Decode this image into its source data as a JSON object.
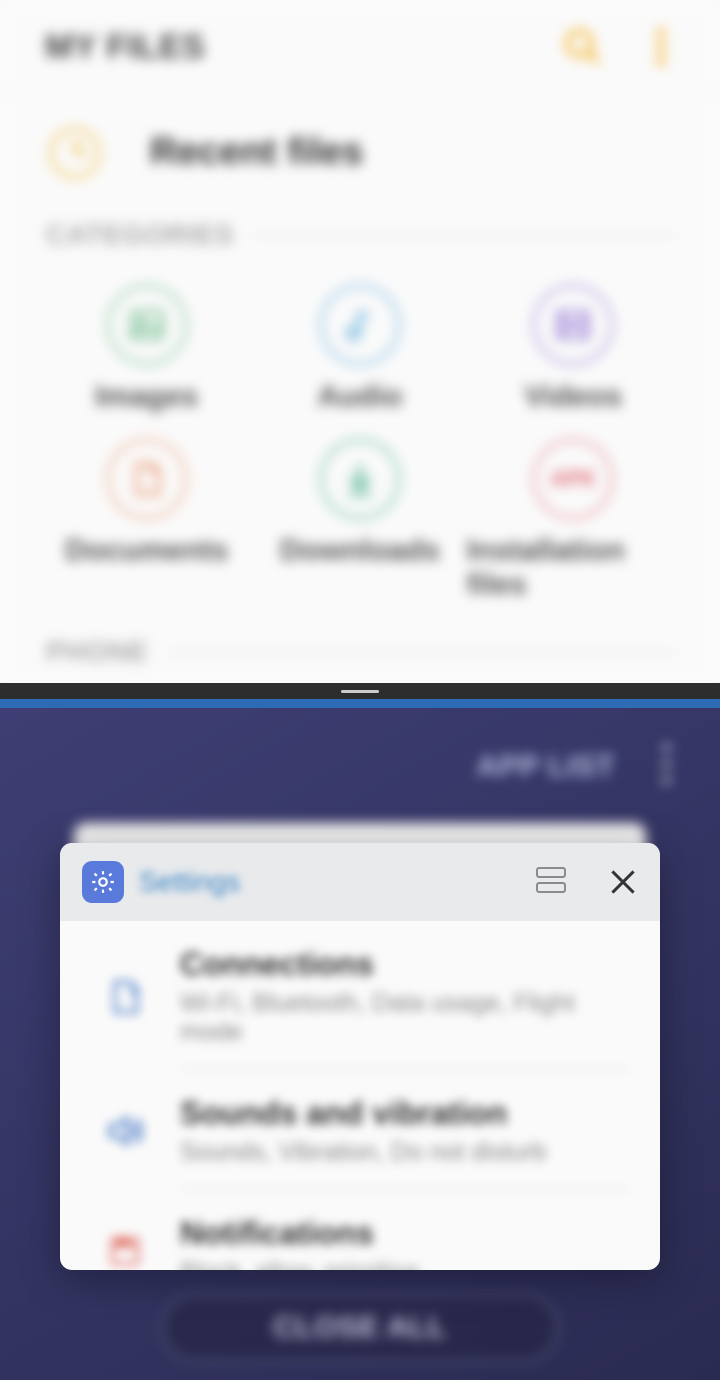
{
  "colors": {
    "accent_orange": "#f4a400",
    "link_blue": "#3d86c5"
  },
  "files": {
    "title": "MY FILES",
    "recent_label": "Recent files",
    "section_categories": "CATEGORIES",
    "section_phone": "PHONE",
    "categories": [
      {
        "label": "Images",
        "icon": "image-icon",
        "color": "#5db37e"
      },
      {
        "label": "Audio",
        "icon": "music-icon",
        "color": "#4aa3d9"
      },
      {
        "label": "Videos",
        "icon": "video-icon",
        "color": "#8a6bd1"
      },
      {
        "label": "Documents",
        "icon": "document-icon",
        "color": "#e88a5e"
      },
      {
        "label": "Downloads",
        "icon": "download-icon",
        "color": "#3aa981"
      },
      {
        "label": "Installation files",
        "icon": "apk-icon",
        "color": "#e06a77",
        "badge": "APK"
      }
    ]
  },
  "recents": {
    "app_list_label": "APP LIST",
    "close_all_label": "CLOSE ALL"
  },
  "settings_card": {
    "app_name": "Settings",
    "rows": [
      {
        "title": "Connections",
        "sub": "Wi-Fi, Bluetooth, Data usage, Flight mode"
      },
      {
        "title": "Sounds and vibration",
        "sub": "Sounds, Vibration, Do not disturb"
      },
      {
        "title": "Notifications",
        "sub": "Block, allow, prioritise"
      }
    ]
  }
}
